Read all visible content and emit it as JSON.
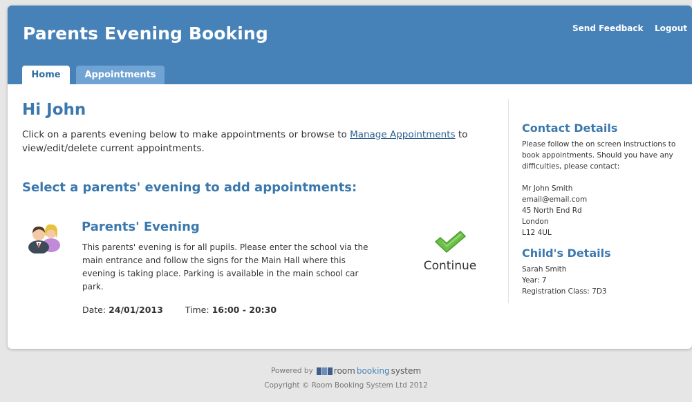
{
  "header": {
    "title": "Parents Evening Booking",
    "links": {
      "feedback": "Send Feedback",
      "logout": "Logout"
    },
    "tabs": [
      {
        "label": "Home"
      },
      {
        "label": "Appointments"
      }
    ]
  },
  "main": {
    "greeting": "Hi John",
    "intro_before": "Click on a parents evening below to make appointments or browse to ",
    "intro_link": "Manage Appointments",
    "intro_after": " to view/edit/delete current appointments.",
    "section_title": "Select a parents' evening to add appointments:",
    "event": {
      "title": "Parents' Evening",
      "description": "This parents' evening is for all pupils. Please enter the school via the main entrance and follow the signs for the Main Hall where this evening is taking place. Parking is available in the main school car park.",
      "date_label": "Date:",
      "date": "24/01/2013",
      "time_label": "Time:",
      "time": "16:00 - 20:30",
      "continue_label": "Continue"
    }
  },
  "sidebar": {
    "contact_heading": "Contact Details",
    "contact_text": "Please follow the on screen instructions to book appointments. Should you have any difficulties, please contact:",
    "contact_lines": [
      "Mr John Smith",
      "email@email.com",
      "45 North End Rd",
      "London",
      "L12 4UL"
    ],
    "child_heading": "Child's Details",
    "child_lines": [
      "Sarah Smith",
      "Year: 7",
      "Registration Class: 7D3"
    ]
  },
  "footer": {
    "powered_by": "Powered by",
    "brand_part1": "room",
    "brand_part2": "booking",
    "brand_part3": "system",
    "copyright": "Copyright © Room Booking System Ltd 2012"
  },
  "colors": {
    "header": "#4682b8",
    "heading": "#3a78ad",
    "tab_inactive": "#6fa3d3",
    "check": "#6cc04a"
  },
  "icons": {
    "event": "parents-icon",
    "continue": "check-icon"
  }
}
